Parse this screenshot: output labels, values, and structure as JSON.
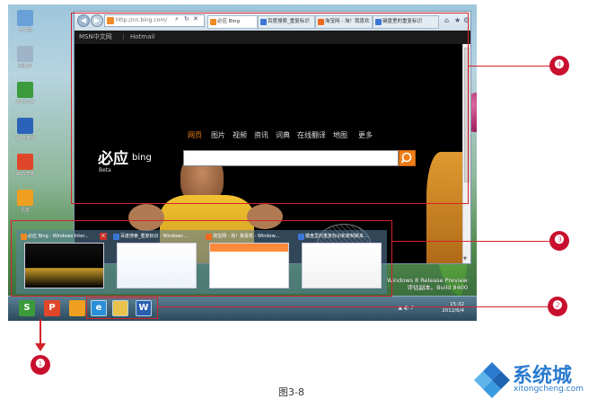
{
  "desktop": {
    "icons": [
      {
        "label": "计算机",
        "color": "#6aa0d8"
      },
      {
        "label": "回收站",
        "color": "#9fb4c8"
      },
      {
        "label": "WPS文字",
        "color": "#3b9a3b"
      },
      {
        "label": "WPS演示",
        "color": "#2a63b8"
      },
      {
        "label": "WPS表格",
        "color": "#e0462a"
      },
      {
        "label": "迅雷",
        "color": "#f0a020"
      }
    ]
  },
  "browser": {
    "address": "http://cn.bing.com/",
    "tabs": [
      {
        "label": "必应 Bing",
        "color": "#f08a24",
        "active": true
      },
      {
        "label": "百度搜索_重复标识",
        "color": "#3b76d6",
        "active": false
      },
      {
        "label": "淘宝网 - 淘！我喜欢",
        "color": "#f06a1e",
        "active": false
      },
      {
        "label": "键盘里的重复标识",
        "color": "#3b76d6",
        "active": false
      }
    ],
    "favorites": [
      "MSN中文网",
      "Hotmail"
    ],
    "bing": {
      "nav": [
        "网页",
        "图片",
        "视频",
        "资讯",
        "词典",
        "在线翻译",
        "地图",
        "更多"
      ],
      "logo_cn": "必应",
      "logo_en": "bing",
      "logo_sub": "Beta"
    }
  },
  "thumbnails": [
    {
      "label": "必应 Bing - Windows Inter...",
      "color": "#f08a24",
      "closable": true
    },
    {
      "label": "百度搜索_重复标识 - Windows ...",
      "color": "#3b76d6",
      "closable": false
    },
    {
      "label": "淘宝网 - 淘！我喜欢 - Window...",
      "color": "#f06a1e",
      "closable": false
    },
    {
      "label": "键盘里的重复标识和复制跳来...",
      "color": "#3b76d6",
      "closable": false
    }
  ],
  "taskbar": {
    "pinned": [
      {
        "name": "WPS文字",
        "color": "#3b9a3b",
        "glyph": "S"
      },
      {
        "name": "WPS演示",
        "color": "#e0462a",
        "glyph": "P"
      },
      {
        "name": "迅雷",
        "color": "#f0a020",
        "glyph": ""
      }
    ],
    "grouped": [
      {
        "name": "Internet Explorer",
        "color": "#2a8fd8",
        "glyph": "e"
      },
      {
        "name": "资源管理器",
        "color": "#e8c24a",
        "glyph": ""
      },
      {
        "name": "Word",
        "color": "#2a5fb0",
        "glyph": "W"
      }
    ],
    "time": "15:32",
    "date": "2012/6/4"
  },
  "watermark": {
    "line1": "Windows 8 Release Preview",
    "line2": "评估副本。Build 8400"
  },
  "callouts": [
    "❶",
    "❷",
    "❸",
    "❹"
  ],
  "caption": "图3-8",
  "brand": {
    "name": "系统城",
    "url": "xitongcheng.com"
  },
  "colors": {
    "callout": "#c8102e",
    "box": "#d4232b",
    "brand": "#2a7bd0"
  }
}
